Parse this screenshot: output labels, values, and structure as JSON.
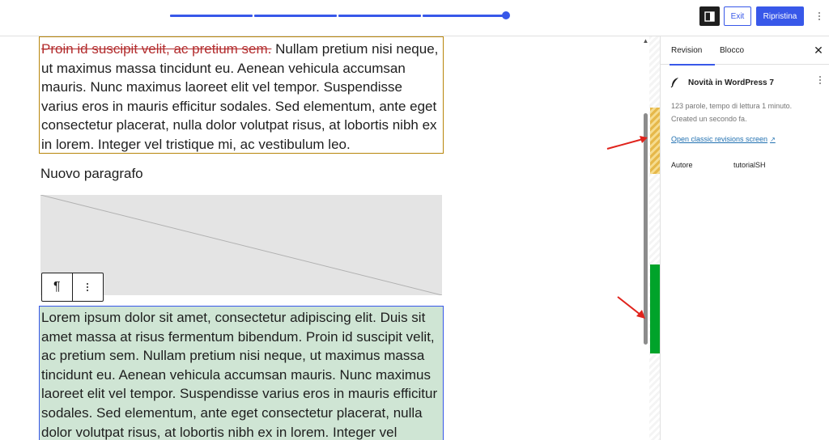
{
  "header": {
    "exit_label": "Exit",
    "restore_label": "Ripristina",
    "sidebar_toggle_icon": "sidebar-toggle-icon",
    "more_icon": "vertical-ellipsis-icon",
    "accent_color": "#3858e9"
  },
  "editor": {
    "removed_block": {
      "deleted_text": "Proin id suscipit velit, ac pretium sem.",
      "remaining_text": " Nullam pretium nisi neque, ut maximus massa tincidunt eu. Aenean vehicula accumsan mauris. Nunc maximus laoreet elit vel tempor. Suspendisse varius eros in mauris efficitur sodales. Sed elementum, ante eget consectetur placerat, nulla dolor volutpat risus, at lobortis nibh ex in lorem. Integer vel tristique mi, ac vestibulum leo.",
      "border_color": "#b8860b"
    },
    "new_paragraph": "Nuovo paragrafo",
    "block_toolbar": {
      "paragraph_icon": "¶",
      "more_icon": "vertical-ellipsis-icon"
    },
    "added_block": {
      "text": "Lorem ipsum dolor sit amet, consectetur adipiscing elit. Duis sit amet massa at risus fermentum bibendum. Proin id suscipit velit, ac pretium sem. Nullam pretium nisi neque, ut maximus massa tincidunt eu. Aenean vehicula accumsan mauris. Nunc maximus laoreet elit vel tempor. Suspendisse varius eros in mauris efficitur sodales. Sed elementum, ante eget consectetur placerat, nulla dolor volutpat risus, at lobortis nibh ex in lorem. Integer vel",
      "background_color": "#cfe5d4",
      "border_color": "#3858e9"
    },
    "change_markers": {
      "removed_color": "#e6b84a",
      "added_color": "#00a32a",
      "annotation_arrow_color": "#e0231c"
    }
  },
  "sidebar": {
    "tabs": [
      {
        "label": "Revision",
        "active": true
      },
      {
        "label": "Blocco",
        "active": false
      }
    ],
    "close_icon": "close-icon",
    "document": {
      "icon": "feather-icon",
      "title": "Novità in WordPress 7",
      "stats": "123 parole, tempo di lettura 1 minuto.",
      "created": "Created un secondo fa.",
      "classic_link": "Open classic revisions screen",
      "classic_link_icon": "↗",
      "author_label": "Autore",
      "author_value": "tutorialSH"
    }
  }
}
